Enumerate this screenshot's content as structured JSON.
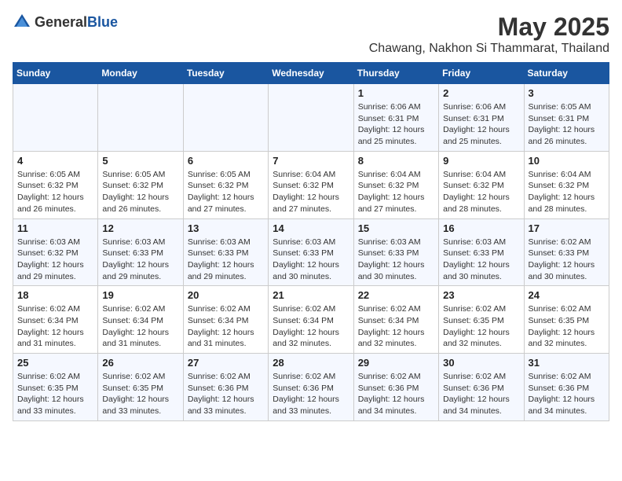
{
  "logo": {
    "general": "General",
    "blue": "Blue"
  },
  "header": {
    "title": "May 2025",
    "subtitle": "Chawang, Nakhon Si Thammarat, Thailand"
  },
  "weekdays": [
    "Sunday",
    "Monday",
    "Tuesday",
    "Wednesday",
    "Thursday",
    "Friday",
    "Saturday"
  ],
  "weeks": [
    [
      {
        "day": "",
        "info": ""
      },
      {
        "day": "",
        "info": ""
      },
      {
        "day": "",
        "info": ""
      },
      {
        "day": "",
        "info": ""
      },
      {
        "day": "1",
        "info": "Sunrise: 6:06 AM\nSunset: 6:31 PM\nDaylight: 12 hours and 25 minutes."
      },
      {
        "day": "2",
        "info": "Sunrise: 6:06 AM\nSunset: 6:31 PM\nDaylight: 12 hours and 25 minutes."
      },
      {
        "day": "3",
        "info": "Sunrise: 6:05 AM\nSunset: 6:31 PM\nDaylight: 12 hours and 26 minutes."
      }
    ],
    [
      {
        "day": "4",
        "info": "Sunrise: 6:05 AM\nSunset: 6:32 PM\nDaylight: 12 hours and 26 minutes."
      },
      {
        "day": "5",
        "info": "Sunrise: 6:05 AM\nSunset: 6:32 PM\nDaylight: 12 hours and 26 minutes."
      },
      {
        "day": "6",
        "info": "Sunrise: 6:05 AM\nSunset: 6:32 PM\nDaylight: 12 hours and 27 minutes."
      },
      {
        "day": "7",
        "info": "Sunrise: 6:04 AM\nSunset: 6:32 PM\nDaylight: 12 hours and 27 minutes."
      },
      {
        "day": "8",
        "info": "Sunrise: 6:04 AM\nSunset: 6:32 PM\nDaylight: 12 hours and 27 minutes."
      },
      {
        "day": "9",
        "info": "Sunrise: 6:04 AM\nSunset: 6:32 PM\nDaylight: 12 hours and 28 minutes."
      },
      {
        "day": "10",
        "info": "Sunrise: 6:04 AM\nSunset: 6:32 PM\nDaylight: 12 hours and 28 minutes."
      }
    ],
    [
      {
        "day": "11",
        "info": "Sunrise: 6:03 AM\nSunset: 6:32 PM\nDaylight: 12 hours and 29 minutes."
      },
      {
        "day": "12",
        "info": "Sunrise: 6:03 AM\nSunset: 6:33 PM\nDaylight: 12 hours and 29 minutes."
      },
      {
        "day": "13",
        "info": "Sunrise: 6:03 AM\nSunset: 6:33 PM\nDaylight: 12 hours and 29 minutes."
      },
      {
        "day": "14",
        "info": "Sunrise: 6:03 AM\nSunset: 6:33 PM\nDaylight: 12 hours and 30 minutes."
      },
      {
        "day": "15",
        "info": "Sunrise: 6:03 AM\nSunset: 6:33 PM\nDaylight: 12 hours and 30 minutes."
      },
      {
        "day": "16",
        "info": "Sunrise: 6:03 AM\nSunset: 6:33 PM\nDaylight: 12 hours and 30 minutes."
      },
      {
        "day": "17",
        "info": "Sunrise: 6:02 AM\nSunset: 6:33 PM\nDaylight: 12 hours and 30 minutes."
      }
    ],
    [
      {
        "day": "18",
        "info": "Sunrise: 6:02 AM\nSunset: 6:34 PM\nDaylight: 12 hours and 31 minutes."
      },
      {
        "day": "19",
        "info": "Sunrise: 6:02 AM\nSunset: 6:34 PM\nDaylight: 12 hours and 31 minutes."
      },
      {
        "day": "20",
        "info": "Sunrise: 6:02 AM\nSunset: 6:34 PM\nDaylight: 12 hours and 31 minutes."
      },
      {
        "day": "21",
        "info": "Sunrise: 6:02 AM\nSunset: 6:34 PM\nDaylight: 12 hours and 32 minutes."
      },
      {
        "day": "22",
        "info": "Sunrise: 6:02 AM\nSunset: 6:34 PM\nDaylight: 12 hours and 32 minutes."
      },
      {
        "day": "23",
        "info": "Sunrise: 6:02 AM\nSunset: 6:35 PM\nDaylight: 12 hours and 32 minutes."
      },
      {
        "day": "24",
        "info": "Sunrise: 6:02 AM\nSunset: 6:35 PM\nDaylight: 12 hours and 32 minutes."
      }
    ],
    [
      {
        "day": "25",
        "info": "Sunrise: 6:02 AM\nSunset: 6:35 PM\nDaylight: 12 hours and 33 minutes."
      },
      {
        "day": "26",
        "info": "Sunrise: 6:02 AM\nSunset: 6:35 PM\nDaylight: 12 hours and 33 minutes."
      },
      {
        "day": "27",
        "info": "Sunrise: 6:02 AM\nSunset: 6:36 PM\nDaylight: 12 hours and 33 minutes."
      },
      {
        "day": "28",
        "info": "Sunrise: 6:02 AM\nSunset: 6:36 PM\nDaylight: 12 hours and 33 minutes."
      },
      {
        "day": "29",
        "info": "Sunrise: 6:02 AM\nSunset: 6:36 PM\nDaylight: 12 hours and 34 minutes."
      },
      {
        "day": "30",
        "info": "Sunrise: 6:02 AM\nSunset: 6:36 PM\nDaylight: 12 hours and 34 minutes."
      },
      {
        "day": "31",
        "info": "Sunrise: 6:02 AM\nSunset: 6:36 PM\nDaylight: 12 hours and 34 minutes."
      }
    ]
  ]
}
